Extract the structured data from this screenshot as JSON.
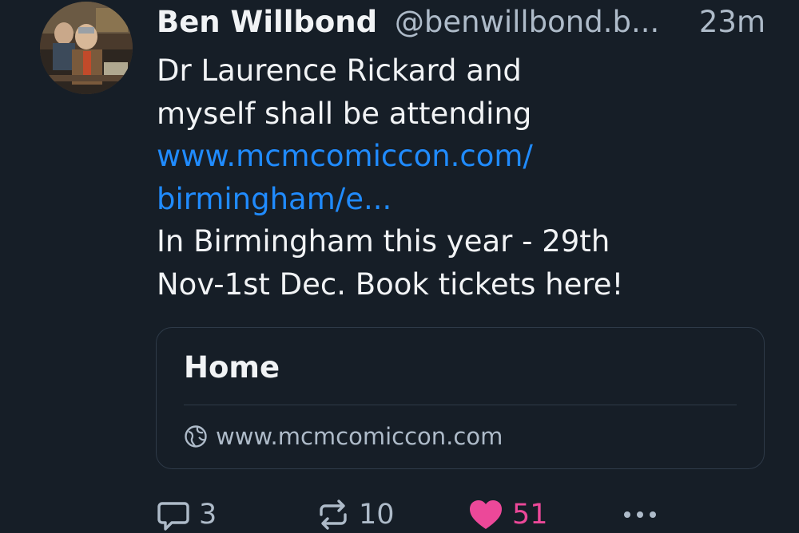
{
  "post": {
    "author_name": "Ben Willbond",
    "author_handle": "@benwillbond.b...",
    "time": "23m",
    "text_lines": [
      "Dr Laurence Rickard and",
      "myself shall be attending"
    ],
    "link_lines": [
      "www.mcmcomiccon.com/",
      "birmingham/e..."
    ],
    "text_after_lines": [
      "In Birmingham this year - 29th",
      "Nov-1st Dec. Book tickets here!"
    ]
  },
  "embed": {
    "title": "Home",
    "domain": "www.mcmcomiccon.com"
  },
  "actions": {
    "reply_count": "3",
    "repost_count": "10",
    "like_count": "51"
  },
  "icons": {
    "reply": "speech-bubble-icon",
    "repost": "repost-arrows-icon",
    "like": "heart-filled-icon",
    "more": "ellipsis-icon",
    "domain": "globe-icon"
  },
  "colors": {
    "background": "#161e27",
    "link": "#208bfe",
    "like": "#ec4899",
    "muted": "#aebbc9"
  }
}
